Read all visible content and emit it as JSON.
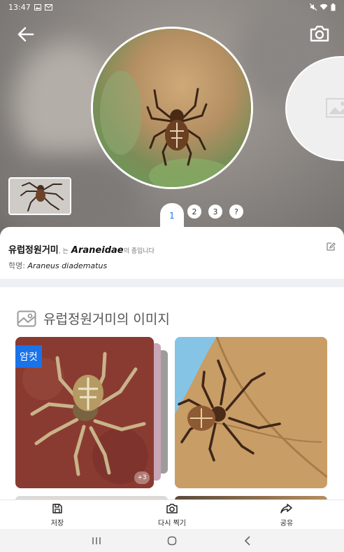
{
  "status_bar": {
    "time": "13:47"
  },
  "hero": {
    "pages": [
      "1",
      "2",
      "3",
      "?"
    ],
    "active_page": "1"
  },
  "species": {
    "common_name": "유럽정원거미",
    "connector": ", 는",
    "family": "Araneidae",
    "family_suffix": "의 종입니다",
    "sci_label": "학명:",
    "scientific_name": "Araneus diadematus"
  },
  "images_section": {
    "title": "유럽정원거미의 이미지",
    "badge": "암컷",
    "more_count": "+3"
  },
  "actions": {
    "save": "저장",
    "retake": "다시 찍기",
    "share": "공유"
  },
  "colors": {
    "accent": "#1a73e8"
  }
}
